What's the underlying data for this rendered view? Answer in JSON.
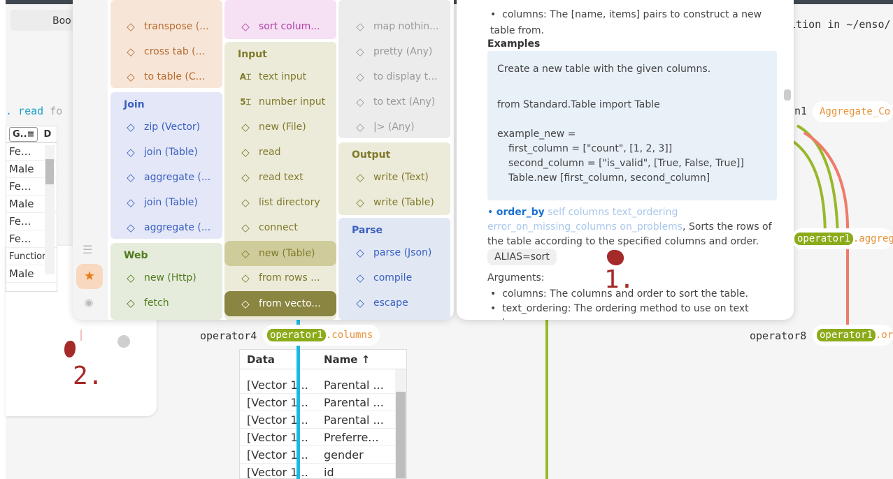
{
  "project": {
    "title_partial": "Boo",
    "path_partial": "dition in ~/enso/"
  },
  "graph": {
    "read_partial": ". read",
    "read_suffix": "fo",
    "node_right_label": "n1",
    "aggregate_label": "Aggregate_Co",
    "operator4": "operator4",
    "operator4_chip": "operator1",
    "operator4_suffix": ".columns",
    "operator8": "operator8",
    "operator8_chip": "operator1",
    "operator8_suffix": ".or",
    "right_chip": "operator1",
    "right_suffix": ".aggreg",
    "left_table": {
      "header_a": "G..≡",
      "header_b": "D",
      "rows": [
        "Fe...",
        "Male",
        "Fe...",
        "Male",
        "Fe...",
        "Fe...",
        "Function",
        "Male"
      ]
    },
    "bottom_table": {
      "headers": [
        "Data",
        "Name ↑"
      ],
      "rows": [
        [
          "[Vector 1...",
          "Parental ..."
        ],
        [
          "[Vector 1...",
          "Parental ..."
        ],
        [
          "[Vector 1...",
          "Parental ..."
        ],
        [
          "[Vector 1...",
          "Preferre..."
        ],
        [
          "[Vector 1...",
          "gender"
        ],
        [
          "[Vector 1...",
          "id"
        ]
      ]
    }
  },
  "browser": {
    "col1_top": [
      {
        "label": "transpose (...",
        "icon": "diamond"
      },
      {
        "label": "cross tab (...",
        "icon": "diamond"
      },
      {
        "label": "to table (C...",
        "icon": "diamond"
      }
    ],
    "join": {
      "title": "Join",
      "items": [
        "zip (Vector)",
        "join (Table)",
        "aggregate (...",
        "join (Table)",
        "aggregate (..."
      ]
    },
    "web": {
      "title": "Web",
      "items": [
        "new (Http)",
        "fetch"
      ]
    },
    "col2_top": "sort colum...",
    "input": {
      "title": "Input",
      "items": [
        "text input",
        "number input",
        "new (File)",
        "read",
        "read text",
        "list directory",
        "connect",
        "new (Table)",
        "from rows ...",
        "from vecto..."
      ]
    },
    "col3_top": [
      "map nothin...",
      "pretty (Any)",
      "to display t...",
      "to text (Any)",
      "|> (Any)"
    ],
    "output": {
      "title": "Output",
      "items": [
        "write (Text)",
        "write (Table)"
      ]
    },
    "parse": {
      "title": "Parse",
      "items": [
        "parse (Json)",
        "compile",
        "escape"
      ]
    },
    "colors": {
      "orange_section": "#f7e6d8",
      "pink_section": "#f6e0f3",
      "join_section": "#e3e7f7",
      "web_section": "#e6ecdc",
      "input_section": "#ecebda",
      "gray_section": "#ececec",
      "output_section": "#ecebda",
      "parse_section": "#e1e8f4",
      "selected": "#cfcc9b",
      "selected_strong": "#8a8540"
    }
  },
  "doc": {
    "arg_columns": "columns: The [name, items] pairs to construct a new table from.",
    "examples_title": "Examples",
    "example_desc": "Create a new table with the given columns.",
    "code_import": "from Standard.Table import Table",
    "code_1": "example_new =",
    "code_2": "first_column = [\"count\", [1, 2, 3]]",
    "code_3": "second_column = [\"is_valid\", [True, False, True]]",
    "code_4": "Table.new [first_column, second_column]",
    "order_by": "order_by",
    "order_by_sig_1": "self columns text_ordering",
    "order_by_sig_2": "error_on_missing_columns on_problems",
    "order_by_desc_1": ", Sorts the rows of",
    "order_by_desc_2": "the table according to the specified columns and order.",
    "alias": "ALIAS=sort",
    "arguments_title": "Arguments:",
    "arg_1": "columns: The columns and order to sort the table.",
    "arg_2": "text_ordering: The ordering method to use on text values."
  },
  "annotations": {
    "one": "1.",
    "two": "2."
  }
}
